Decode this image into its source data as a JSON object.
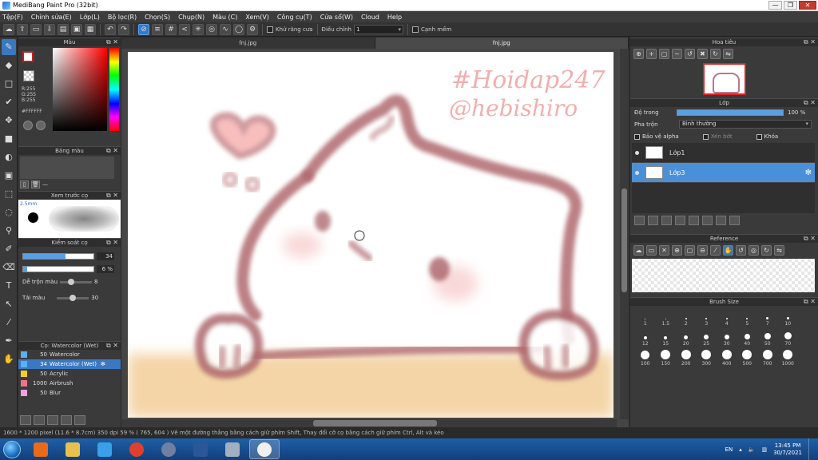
{
  "window": {
    "title": "MediBang Paint Pro (32bit)",
    "controls": [
      "—",
      "❐",
      "✕"
    ]
  },
  "menu": [
    "Tệp(F)",
    "Chỉnh sửa(E)",
    "Lớp(L)",
    "Bộ lọc(R)",
    "Chọn(S)",
    "Chụp(N)",
    "Màu (C)",
    "Xem(V)",
    "Công cụ(T)",
    "Cửa sổ(W)",
    "Cloud",
    "Help"
  ],
  "toolbar": {
    "antialias_label": "Khử răng cưa",
    "correction_label": "Điều chỉnh",
    "correction_value": "1",
    "snap_label": "Cạnh mềm"
  },
  "color_panel": {
    "title": "Màu",
    "r": "R:255",
    "g": "G:255",
    "b": "B:255",
    "hex": "#FFFFFF"
  },
  "palette_panel": {
    "title": "Bảng màu",
    "dash": "—"
  },
  "brush_preview": {
    "title": "Xem trước cọ",
    "size": "2.5mm"
  },
  "brush_control": {
    "title": "Kiểm soát cọ",
    "size_value": "34",
    "size_fraction": 0.6,
    "opacity_value": "6 %",
    "opacity_fraction": 0.06,
    "blend_label": "Dễ trộn màu",
    "blend_value": "8",
    "blend_fraction": 0.3,
    "refill_label": "Tải màu",
    "refill_value": "30",
    "refill_fraction": 0.5
  },
  "brush_list": {
    "title": "Cọ: Watercolor (Wet)",
    "items": [
      {
        "size": "50",
        "name": "Watercolor",
        "color": "#5ab0f0"
      },
      {
        "size": "34",
        "name": "Watercolor (Wet)",
        "color": "#5ab0f0"
      },
      {
        "size": "50",
        "name": "Acrylic",
        "color": "#f0d020"
      },
      {
        "size": "1000",
        "name": "Airbrush",
        "color": "#f07090"
      },
      {
        "size": "50",
        "name": "Blur",
        "color": "#f0a0e0"
      }
    ]
  },
  "doc_tabs": [
    "fnj.jpg",
    "fnj.jpg"
  ],
  "canvas": {
    "hashtag": "#Hoidap247",
    "handle": "@hebishiro"
  },
  "navigator": {
    "title": "Hoa tiêu"
  },
  "layer_panel": {
    "title": "Lớp",
    "opacity_label": "Độ trong",
    "opacity_value": "100 %",
    "blend_label": "Pha trộn",
    "blend_value": "Bình thường",
    "protect_alpha": "Bảo vệ alpha",
    "clipping": "Xén bớt",
    "lock": "Khóa",
    "layers": [
      {
        "name": "Lớp1",
        "selected": false
      },
      {
        "name": "Lớp3",
        "selected": true
      }
    ]
  },
  "reference_panel": {
    "title": "Reference"
  },
  "brush_size_panel": {
    "title": "Brush Size",
    "sizes": [
      "1",
      "1.5",
      "2",
      "3",
      "4",
      "5",
      "7",
      "10",
      "12",
      "15",
      "20",
      "25",
      "30",
      "40",
      "50",
      "70",
      "100",
      "150",
      "200",
      "300",
      "400",
      "500",
      "700",
      "1000"
    ]
  },
  "status": "1600 * 1200 pixel   (11.6 * 8.7cm)   350 dpi   59 %   ( 765, 604 )   Vẽ một đường thẳng bằng cách giữ phím Shift, Thay đổi cỡ cọ bằng cách giữ phím Ctrl, Alt và kéo",
  "taskbar": {
    "lang": "EN",
    "time": "13:45 PM",
    "date": "30/7/2021",
    "apps": [
      {
        "name": "media-player",
        "color": "#e86a1a"
      },
      {
        "name": "file-explorer",
        "color": "#e8c050"
      },
      {
        "name": "internet-explorer",
        "color": "#3aa0e8"
      },
      {
        "name": "chrome",
        "color": "#e04030"
      },
      {
        "name": "disk-utility",
        "color": "#7080a0"
      },
      {
        "name": "word",
        "color": "#2b5797"
      },
      {
        "name": "paint-tool",
        "color": "#a0b0c0"
      },
      {
        "name": "medibang",
        "color": "#f0f0f0"
      }
    ]
  },
  "colors": {
    "accent": "#3b78c2",
    "panel": "#3a3a3a",
    "stroke": "#b06a70",
    "wash": "#e8b070"
  }
}
